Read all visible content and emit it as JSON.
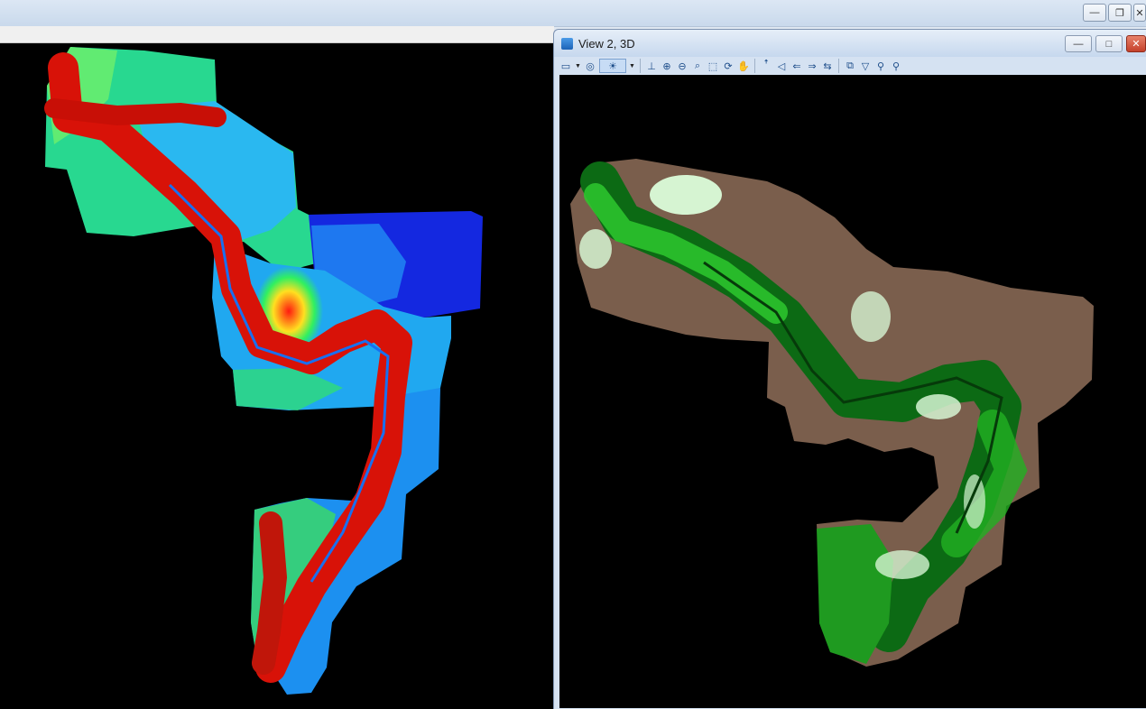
{
  "app": {
    "controls": {
      "minimize": "—",
      "restore": "❐",
      "close": "✕"
    }
  },
  "view2": {
    "title": "View 2, 3D",
    "controls": {
      "minimize": "—",
      "maximize": "□",
      "close": "✕"
    },
    "toolbar": [
      {
        "name": "view-attributes-icon",
        "glyph": "▭"
      },
      {
        "name": "dropdown-arrow-icon",
        "glyph": "▼",
        "drop": true
      },
      {
        "name": "display-style-icon",
        "glyph": "◎"
      },
      {
        "name": "lighting-icon",
        "glyph": "☀",
        "boxed": true
      },
      {
        "name": "dropdown-arrow-icon",
        "glyph": "▼",
        "drop": true
      },
      {
        "name": "update-view-icon",
        "glyph": "⊥"
      },
      {
        "name": "zoom-in-icon",
        "glyph": "⊕"
      },
      {
        "name": "zoom-out-icon",
        "glyph": "⊖"
      },
      {
        "name": "window-area-icon",
        "glyph": "⌕"
      },
      {
        "name": "fit-view-icon",
        "glyph": "⬚"
      },
      {
        "name": "rotate-view-icon",
        "glyph": "⟳"
      },
      {
        "name": "pan-view-icon",
        "glyph": "✋"
      },
      {
        "name": "walk-icon",
        "glyph": "ꜛ"
      },
      {
        "name": "camera-icon",
        "glyph": "◁"
      },
      {
        "name": "previous-view-icon",
        "glyph": "⇐"
      },
      {
        "name": "next-view-icon",
        "glyph": "⇒"
      },
      {
        "name": "copy-view-icon",
        "glyph": "⇆"
      },
      {
        "name": "clip-volume-icon",
        "glyph": "⧉"
      },
      {
        "name": "clip-mask-icon",
        "glyph": "▽"
      },
      {
        "name": "view-tools-icon",
        "glyph": "⚲"
      },
      {
        "name": "view-tools-extra-icon",
        "glyph": "⚲"
      }
    ]
  },
  "colors": {
    "view_background": "#000000",
    "elevation_low": "#1020e8",
    "elevation_mid": "#22c8f0",
    "elevation_high": "#28e060",
    "elevation_peak": "#e81810",
    "class_ground": "#7d5a4a",
    "class_vegetation": "#1a8a1a",
    "class_low_vegetation": "#d8f5d8"
  }
}
